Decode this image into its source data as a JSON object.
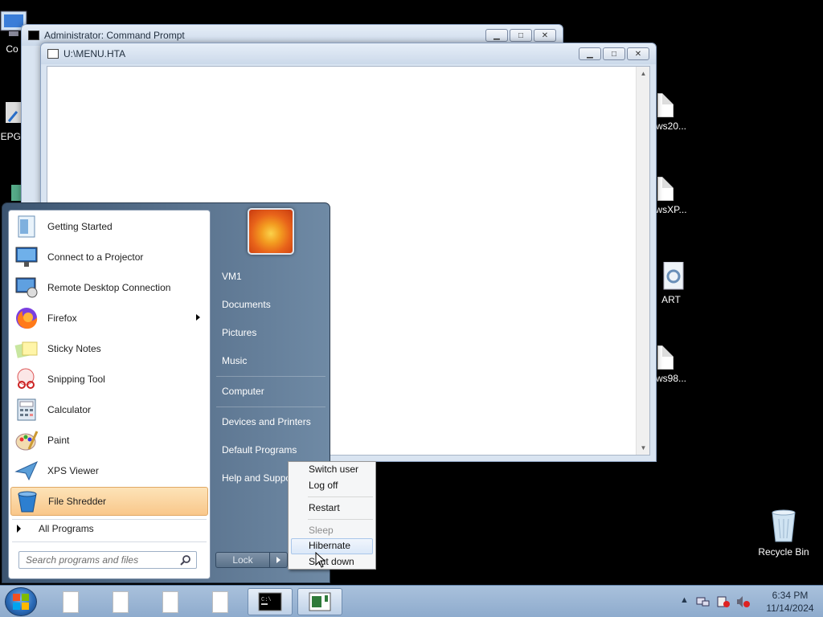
{
  "desktop": {
    "icons": [
      {
        "label": "Co",
        "kind": "computer"
      },
      {
        "label": "EPG:",
        "kind": "app"
      },
      {
        "label": "ws20...",
        "kind": "doc"
      },
      {
        "label": "wsXP...",
        "kind": "doc"
      },
      {
        "label": "ART",
        "kind": "gear"
      },
      {
        "label": "ws98...",
        "kind": "doc"
      },
      {
        "label": "Recycle Bin",
        "kind": "recycle"
      }
    ]
  },
  "windows": {
    "cmd": {
      "title": "Administrator: Command Prompt"
    },
    "hta": {
      "title": "U:\\MENU.HTA"
    }
  },
  "start_menu": {
    "programs": [
      {
        "label": "Getting Started",
        "icon": "getting-started-icon"
      },
      {
        "label": "Connect to a Projector",
        "icon": "projector-icon"
      },
      {
        "label": "Remote Desktop Connection",
        "icon": "remote-desktop-icon"
      },
      {
        "label": "Firefox",
        "icon": "firefox-icon",
        "has_submenu": true
      },
      {
        "label": "Sticky Notes",
        "icon": "sticky-notes-icon"
      },
      {
        "label": "Snipping Tool",
        "icon": "snipping-tool-icon"
      },
      {
        "label": "Calculator",
        "icon": "calculator-icon"
      },
      {
        "label": "Paint",
        "icon": "paint-icon"
      },
      {
        "label": "XPS Viewer",
        "icon": "xps-viewer-icon"
      },
      {
        "label": "File Shredder",
        "icon": "file-shredder-icon",
        "highlighted": true
      }
    ],
    "all_programs": "All Programs",
    "search_placeholder": "Search programs and files",
    "right_links": [
      "VM1",
      "Documents",
      "Pictures",
      "Music",
      "Computer",
      "Devices and Printers",
      "Default Programs",
      "Help and Suppo"
    ],
    "lock_label": "Lock"
  },
  "power_menu": {
    "items": [
      {
        "label": "Switch user",
        "state": "normal"
      },
      {
        "label": "Log off",
        "state": "normal"
      },
      {
        "label": "Restart",
        "state": "normal"
      },
      {
        "label": "Sleep",
        "state": "disabled"
      },
      {
        "label": "Hibernate",
        "state": "highlighted"
      },
      {
        "label": "Shut down",
        "state": "normal"
      }
    ]
  },
  "taskbar": {
    "clock_time": "6:34 PM",
    "clock_date": "11/14/2024",
    "buttons": [
      "document",
      "document",
      "document",
      "document",
      "command-prompt",
      "hta-window"
    ]
  },
  "colors": {
    "highlight": "#f9c78a",
    "start_menu_bg": "#4f6983",
    "taskbar": "#9ab5d4"
  }
}
